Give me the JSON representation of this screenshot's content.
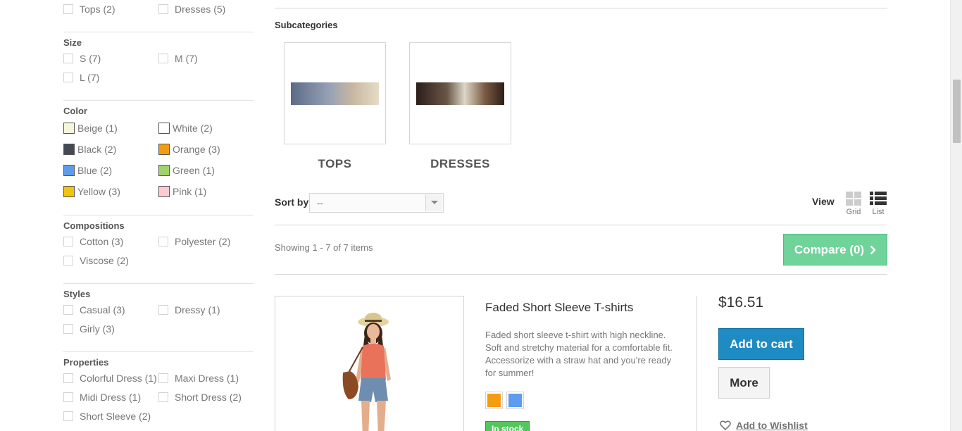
{
  "filters": {
    "categories": {
      "items": [
        {
          "label": "Tops (2)"
        },
        {
          "label": "Dresses (5)"
        }
      ]
    },
    "size": {
      "title": "Size",
      "items": [
        {
          "label": "S (7)"
        },
        {
          "label": "M (7)"
        },
        {
          "label": "L (7)"
        }
      ]
    },
    "color": {
      "title": "Color",
      "items": [
        {
          "label": "Beige (1)",
          "hex": "#f5f5dc"
        },
        {
          "label": "White (2)",
          "hex": "#ffffff"
        },
        {
          "label": "Black (2)",
          "hex": "#434a54"
        },
        {
          "label": "Orange (3)",
          "hex": "#f39c11"
        },
        {
          "label": "Blue (2)",
          "hex": "#5d9cec"
        },
        {
          "label": "Green (1)",
          "hex": "#a0d468"
        },
        {
          "label": "Yellow (3)",
          "hex": "#f1c40f"
        },
        {
          "label": "Pink (1)",
          "hex": "#fcccd2"
        }
      ]
    },
    "compositions": {
      "title": "Compositions",
      "items": [
        {
          "label": "Cotton (3)"
        },
        {
          "label": "Polyester (2)"
        },
        {
          "label": "Viscose (2)"
        }
      ]
    },
    "styles": {
      "title": "Styles",
      "items": [
        {
          "label": "Casual (3)"
        },
        {
          "label": "Dressy (1)"
        },
        {
          "label": "Girly (3)"
        }
      ]
    },
    "properties": {
      "title": "Properties",
      "items": [
        {
          "label": "Colorful Dress (1)"
        },
        {
          "label": "Maxi Dress (1)"
        },
        {
          "label": "Midi Dress (1)"
        },
        {
          "label": "Short Dress (2)"
        },
        {
          "label": "Short Sleeve (2)"
        }
      ]
    }
  },
  "subcategories": {
    "title": "Subcategories",
    "items": [
      {
        "name": "TOPS"
      },
      {
        "name": "DRESSES"
      }
    ]
  },
  "toolbar": {
    "sort_label": "Sort by",
    "sort_value": "--",
    "view_label": "View",
    "grid_label": "Grid",
    "list_label": "List",
    "showing": "Showing 1 - 7 of 7 items",
    "compare_label": "Compare (0)"
  },
  "product": {
    "name": "Faded Short Sleeve T-shirts",
    "description": "Faded short sleeve t-shirt with high neckline. Soft and stretchy material for a comfortable fit. Accessorize with a straw hat and you're ready for summer!",
    "price": "$16.51",
    "colors": [
      "#f39c11",
      "#5d9cec"
    ],
    "stock": "In stock",
    "add_to_cart": "Add to cart",
    "more": "More",
    "wishlist": "Add to Wishlist"
  },
  "theme": {
    "compare_green": "#6fd39a",
    "cart_blue": "#1e8bc3",
    "stock_green": "#55c65e"
  }
}
